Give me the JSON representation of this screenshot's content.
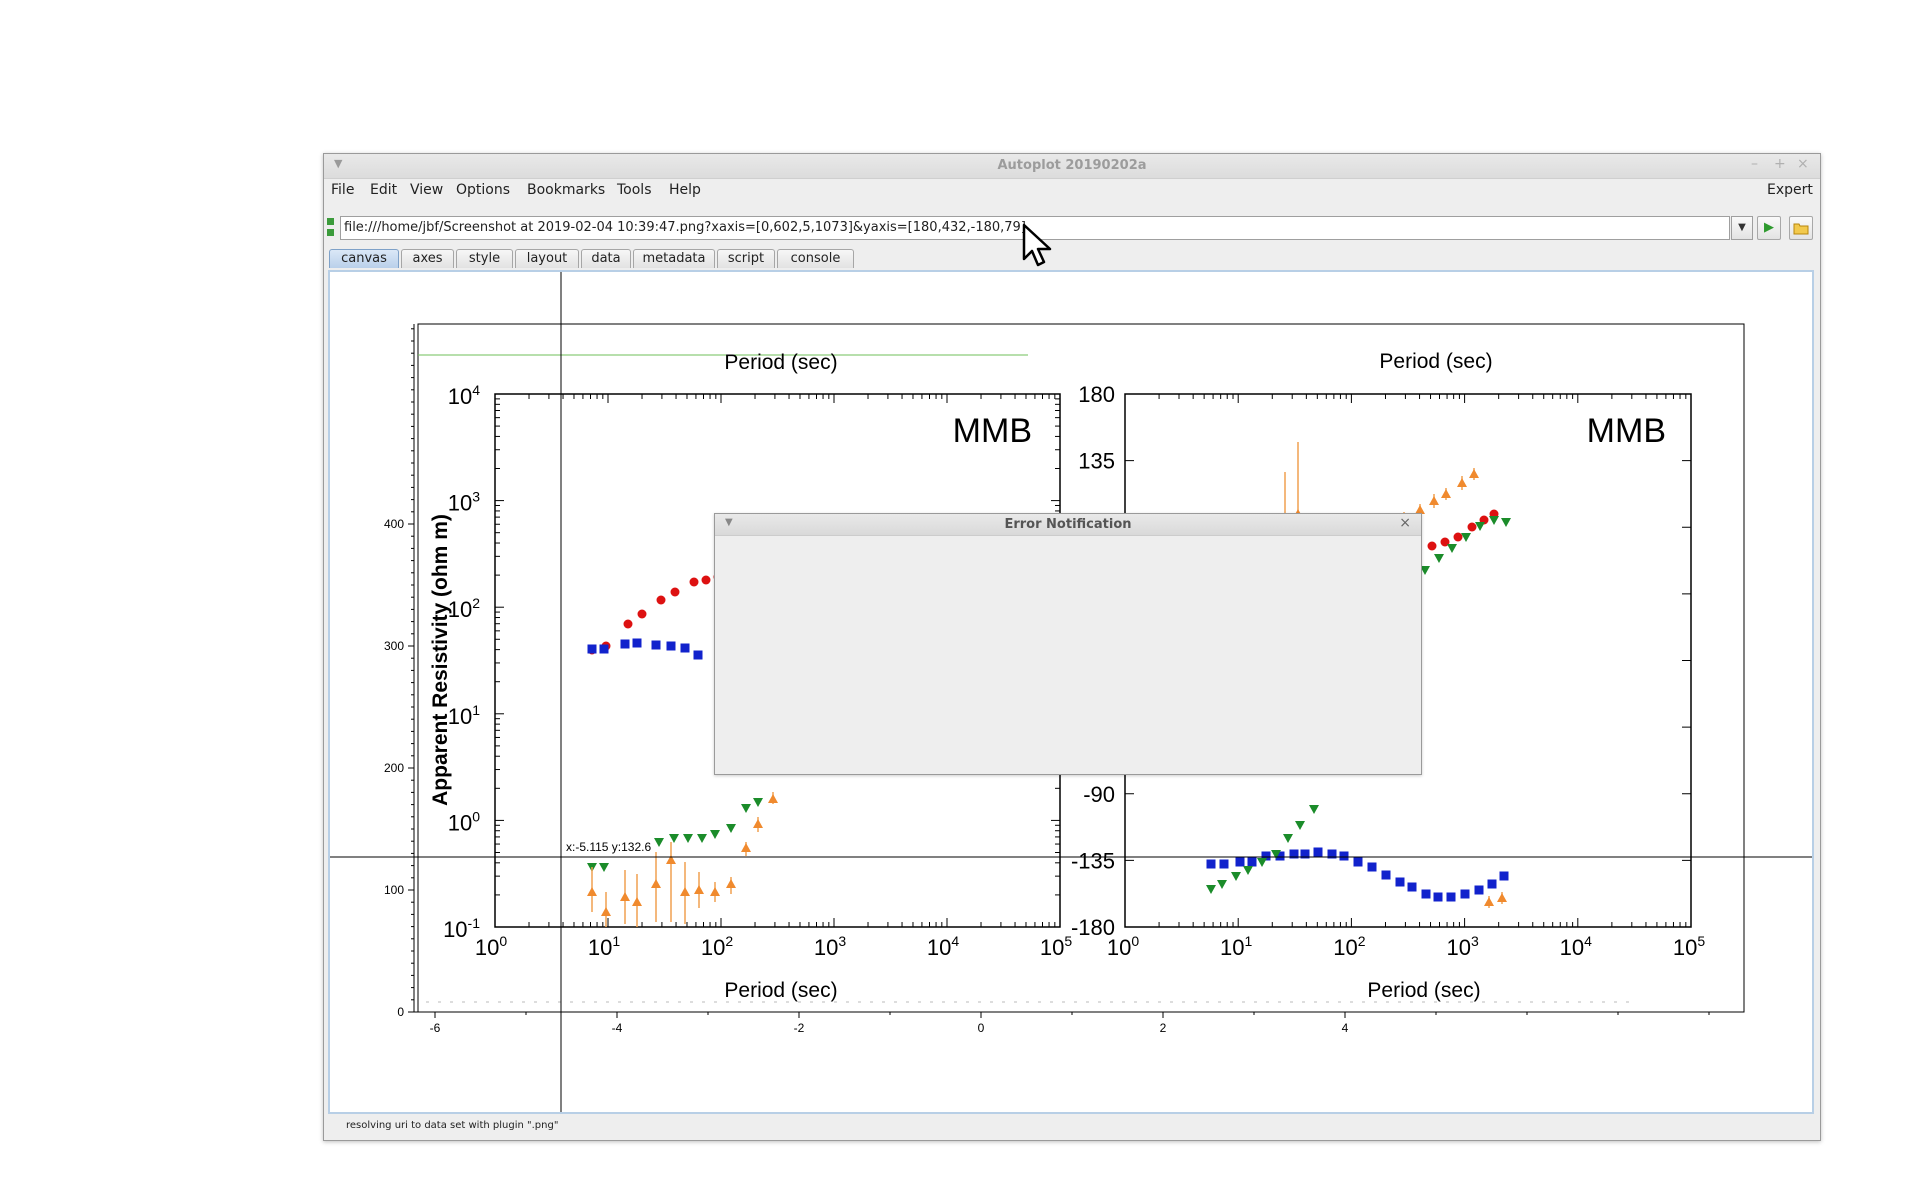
{
  "window": {
    "title": "Autoplot 20190202a",
    "controls": [
      "–",
      "+",
      "×"
    ]
  },
  "menu": {
    "items": [
      "File",
      "Edit",
      "View",
      "Options",
      "Bookmarks",
      "Tools",
      "Help"
    ],
    "expert": "Expert"
  },
  "uri": {
    "value": "file:///home/jbf/Screenshot at 2019-02-04 10:39:47.png?xaxis=[0,602,5,1073]&yaxis=[180,432,-180,79]"
  },
  "tabs": [
    "canvas",
    "axes",
    "style",
    "layout",
    "data",
    "metadata",
    "script",
    "console"
  ],
  "active_tab": "canvas",
  "plot": {
    "x_ticks": [
      "-6",
      "-4",
      "-2",
      "0",
      "2",
      "4"
    ],
    "y_ticks": [
      "0",
      "100",
      "200",
      "300",
      "400"
    ],
    "crosshair_readout": "x:-5.115  y:132.6"
  },
  "image": {
    "left_panel": {
      "top_label": "Period (sec)",
      "bottom_label": "Period (sec)",
      "ylabel": "Apparent Resistivity (ohm m)",
      "badge": "MMB",
      "y_exponents": [
        "4",
        "3",
        "2",
        "1",
        "0",
        "-1"
      ],
      "x_exponents": [
        "0",
        "1",
        "2",
        "3",
        "4",
        "5"
      ],
      "tick_base": "10"
    },
    "right_panel": {
      "top_label": "Period (sec)",
      "bottom_label": "Period (sec)",
      "badge": "MMB",
      "y_ticks": [
        "180",
        "135",
        "-90",
        "-135",
        "-180"
      ],
      "x_exponents": [
        "0",
        "1",
        "2",
        "3",
        "4",
        "5"
      ],
      "tick_base": "10"
    }
  },
  "dialog": {
    "title": "Error Notification",
    "close": "×"
  },
  "status": "resolving uri to data set with plugin \".png\""
}
